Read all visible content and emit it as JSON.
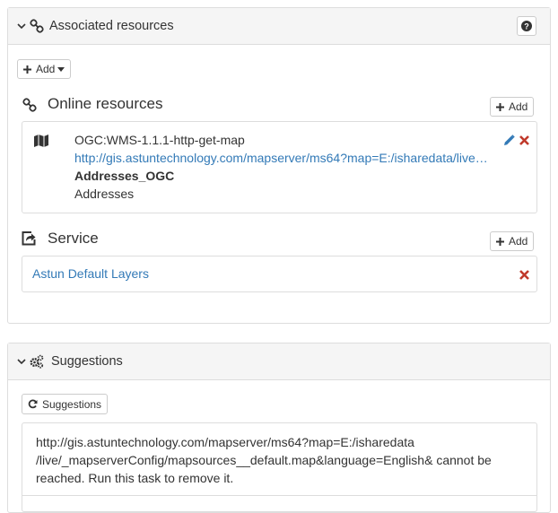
{
  "associated": {
    "title": "Associated resources",
    "add_label": "Add",
    "online": {
      "title": "Online resources",
      "add_label": "Add",
      "item": {
        "protocol": "OGC:WMS-1.1.1-http-get-map",
        "url": "http://gis.astuntechnology.com/mapserver/ms64?map=E:/isharedata/live…",
        "name": "Addresses_OGC",
        "description": "Addresses"
      }
    },
    "service": {
      "title": "Service",
      "add_label": "Add",
      "item": {
        "link": "Astun Default Layers"
      }
    }
  },
  "suggestions": {
    "title": "Suggestions",
    "button_label": "Suggestions",
    "message_lines": [
      "http://gis.astuntechnology.com/mapserver/ms64?map=E:/isharedata",
      "/live/_mapserverConfig/mapsources__default.map&language=English& cannot be",
      "reached. Run this task to remove it."
    ]
  },
  "colors": {
    "link": "#337ab7",
    "remove": "#c0392b",
    "edit": "#337ab7"
  },
  "icons": [
    "chevron-down-icon",
    "link-icon",
    "question-icon",
    "plus-icon",
    "caret-down-icon",
    "map-icon",
    "pencil-icon",
    "remove-icon",
    "share-icon",
    "cogs-icon",
    "refresh-icon"
  ]
}
